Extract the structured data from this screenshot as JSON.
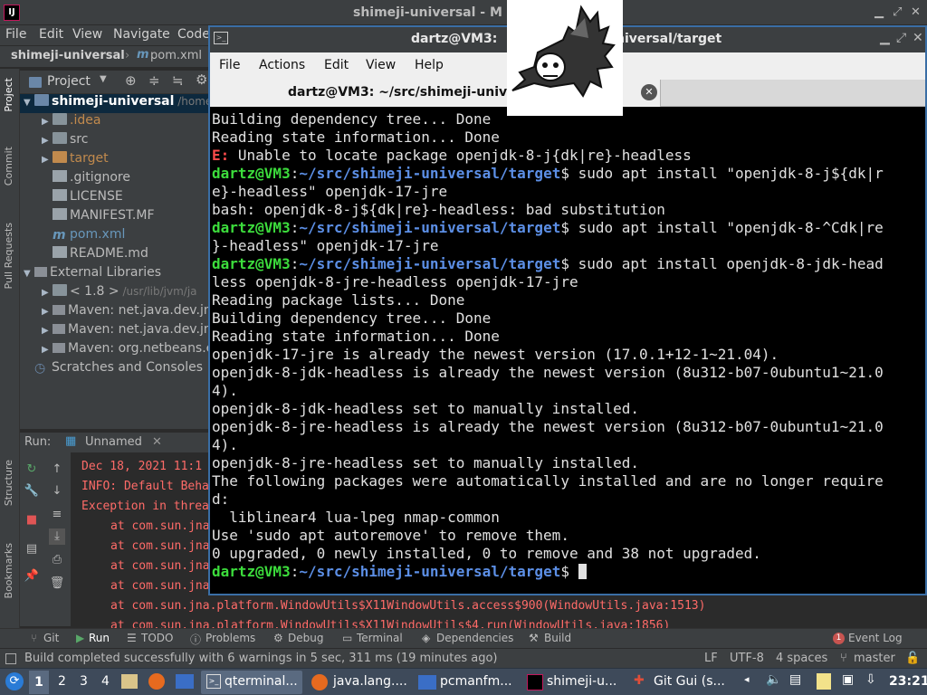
{
  "ide": {
    "title": "shimeji-universal - M",
    "logo_text": "IJ",
    "menu": [
      "File",
      "Edit",
      "View",
      "Navigate",
      "Code"
    ],
    "navbar": {
      "project": "shimeji-universal",
      "file": "pom.xml"
    },
    "project_panel": {
      "title": "Project"
    },
    "tree": [
      {
        "label": "shimeji-universal",
        "suffix": "/home",
        "icon": "folder-blue",
        "depth": 0,
        "expanded": true,
        "selected": true
      },
      {
        "label": ".idea",
        "icon": "folder-gray",
        "depth": 1,
        "color": "#c18a4d"
      },
      {
        "label": "src",
        "icon": "folder-gray",
        "depth": 1
      },
      {
        "label": "target",
        "icon": "folder-orange",
        "depth": 1,
        "color": "#c18a4d"
      },
      {
        "label": ".gitignore",
        "icon": "file",
        "depth": 1,
        "leaf": true
      },
      {
        "label": "LICENSE",
        "icon": "file",
        "depth": 1,
        "leaf": true
      },
      {
        "label": "MANIFEST.MF",
        "icon": "file",
        "depth": 1,
        "leaf": true
      },
      {
        "label": "pom.xml",
        "icon": "maven",
        "depth": 1,
        "leaf": true,
        "color": "#6897bb"
      },
      {
        "label": "README.md",
        "icon": "file",
        "depth": 1,
        "leaf": true
      },
      {
        "label": "External Libraries",
        "icon": "library",
        "depth": 0,
        "expanded": true
      },
      {
        "label": "< 1.8 >",
        "suffix": "/usr/lib/jvm/ja",
        "icon": "folder-gray",
        "depth": 1
      },
      {
        "label": "Maven: net.java.dev.jn",
        "icon": "library",
        "depth": 1
      },
      {
        "label": "Maven: net.java.dev.jn",
        "icon": "library",
        "depth": 1
      },
      {
        "label": "Maven: org.netbeans.e",
        "icon": "library",
        "depth": 1
      },
      {
        "label": "Scratches and Consoles",
        "icon": "scratch",
        "depth": 0,
        "leaf": true
      }
    ],
    "left_vertical_tabs": [
      "Project",
      "Commit",
      "Pull Requests",
      "Structure",
      "Bookmarks"
    ],
    "run_panel": {
      "label": "Run:",
      "config": "Unnamed",
      "lines": [
        {
          "text": "Dec 18, 2021 11:1",
          "indent": 0
        },
        {
          "text": "INFO: Default Beha",
          "indent": 0
        },
        {
          "text": "Exception in threa",
          "indent": 0
        },
        {
          "text": "at com.sun.jna",
          "indent": 1
        },
        {
          "text": "at com.sun.jna",
          "indent": 1
        },
        {
          "text": "at com.sun.jna",
          "indent": 1
        },
        {
          "text": "at com.sun.jna",
          "indent": 1
        },
        {
          "text": "at com.sun.jna.platform.WindowUtils$X11WindowUtils.access$900(WindowUtils.java:1513)",
          "indent": 1
        },
        {
          "text": "at com.sun.jna.platform.WindowUtils$X11WindowUtils$4.run(WindowUtils.java:1856)",
          "indent": 1
        }
      ]
    },
    "bottom_tabs": [
      "Git",
      "Run",
      "TODO",
      "Problems",
      "Debug",
      "Terminal",
      "Dependencies",
      "Build"
    ],
    "event_log": {
      "count": "1",
      "label": "Event Log"
    },
    "status": {
      "message": "Build completed successfully with 6 warnings in 5 sec, 311 ms (19 minutes ago)",
      "line_sep": "LF",
      "encoding": "UTF-8",
      "indent": "4 spaces",
      "branch": "master"
    }
  },
  "terminal": {
    "title_left": "dartz@VM3:",
    "title_right": "niversal/target",
    "menu": [
      "File",
      "Actions",
      "Edit",
      "View",
      "Help"
    ],
    "tab_title": "dartz@VM3: ~/src/shimeji-univers",
    "lines": [
      [
        {
          "t": "Building dependency tree... Done",
          "c": "n"
        }
      ],
      [
        {
          "t": "Reading state information... Done",
          "c": "n"
        }
      ],
      [
        {
          "t": "E:",
          "c": "err"
        },
        {
          "t": " Unable to locate package openjdk-8-j{dk|re}-headless",
          "c": "n"
        }
      ],
      [
        {
          "t": "dartz@VM3",
          "c": "pu"
        },
        {
          "t": ":",
          "c": "n"
        },
        {
          "t": "~/src/shimeji-universal/target",
          "c": "pp"
        },
        {
          "t": "$ sudo apt install \"openjdk-8-j${dk|r",
          "c": "n"
        }
      ],
      [
        {
          "t": "e}-headless\" openjdk-17-jre",
          "c": "n"
        }
      ],
      [
        {
          "t": "bash: openjdk-8-j${dk|re}-headless: bad substitution",
          "c": "n"
        }
      ],
      [
        {
          "t": "dartz@VM3",
          "c": "pu"
        },
        {
          "t": ":",
          "c": "n"
        },
        {
          "t": "~/src/shimeji-universal/target",
          "c": "pp"
        },
        {
          "t": "$ sudo apt install \"openjdk-8-^Cdk|re",
          "c": "n"
        }
      ],
      [
        {
          "t": "}-headless\" openjdk-17-jre",
          "c": "n"
        }
      ],
      [
        {
          "t": "dartz@VM3",
          "c": "pu"
        },
        {
          "t": ":",
          "c": "n"
        },
        {
          "t": "~/src/shimeji-universal/target",
          "c": "pp"
        },
        {
          "t": "$ sudo apt install openjdk-8-jdk-head",
          "c": "n"
        }
      ],
      [
        {
          "t": "less openjdk-8-jre-headless openjdk-17-jre",
          "c": "n"
        }
      ],
      [
        {
          "t": "Reading package lists... Done",
          "c": "n"
        }
      ],
      [
        {
          "t": "Building dependency tree... Done",
          "c": "n"
        }
      ],
      [
        {
          "t": "Reading state information... Done",
          "c": "n"
        }
      ],
      [
        {
          "t": "openjdk-17-jre is already the newest version (17.0.1+12-1~21.04).",
          "c": "n"
        }
      ],
      [
        {
          "t": "openjdk-8-jdk-headless is already the newest version (8u312-b07-0ubuntu1~21.0",
          "c": "n"
        }
      ],
      [
        {
          "t": "4).",
          "c": "n"
        }
      ],
      [
        {
          "t": "openjdk-8-jdk-headless set to manually installed.",
          "c": "n"
        }
      ],
      [
        {
          "t": "openjdk-8-jre-headless is already the newest version (8u312-b07-0ubuntu1~21.0",
          "c": "n"
        }
      ],
      [
        {
          "t": "4).",
          "c": "n"
        }
      ],
      [
        {
          "t": "openjdk-8-jre-headless set to manually installed.",
          "c": "n"
        }
      ],
      [
        {
          "t": "The following packages were automatically installed and are no longer require",
          "c": "n"
        }
      ],
      [
        {
          "t": "d:",
          "c": "n"
        }
      ],
      [
        {
          "t": "  liblinear4 lua-lpeg nmap-common",
          "c": "n"
        }
      ],
      [
        {
          "t": "Use 'sudo apt autoremove' to remove them.",
          "c": "n"
        }
      ],
      [
        {
          "t": "0 upgraded, 0 newly installed, 0 to remove and 38 not upgraded.",
          "c": "n"
        }
      ]
    ],
    "prompt": {
      "user": "dartz@VM3",
      "path": "~/src/shimeji-universal/target",
      "symbol": "$ "
    }
  },
  "taskbar": {
    "workspaces": [
      "1",
      "2",
      "3",
      "4"
    ],
    "tasks": [
      "qterminal...",
      "java.lang....",
      "pcmanfm...",
      "shimeji-u...",
      "Git Gui (s..."
    ],
    "clock": "23:21"
  }
}
